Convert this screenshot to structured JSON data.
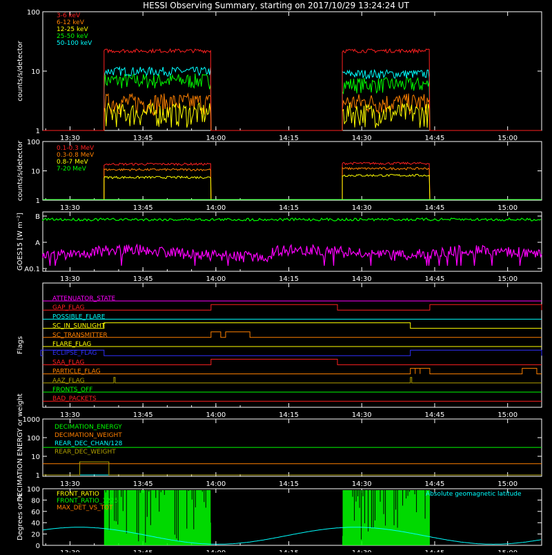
{
  "title": "HESSI Observing Summary, starting on 2017/10/29 13:24:24 UT",
  "time_ticks": [
    "13:30",
    "13:45",
    "14:00",
    "14:15",
    "14:30",
    "14:45",
    "15:00"
  ],
  "colors": {
    "background": "#000000",
    "axes": "#ffffff",
    "red": "#ff2020",
    "orange": "#ff8000",
    "yellow": "#ffff00",
    "green": "#00ff00",
    "cyan": "#00ffff",
    "magenta": "#ff00ff",
    "blue": "#3030ff",
    "olive": "#b0a000"
  },
  "chart_data": [
    {
      "type": "line",
      "panel": "count-rate-low",
      "ylabel": "counts/s/detector",
      "yscale": "log",
      "ylim": [
        1,
        100
      ],
      "yticks": [
        "1",
        "10",
        "100"
      ],
      "x_range": [
        "13:24:24",
        "15:07"
      ],
      "series": [
        {
          "name": "3-6 keV",
          "color": "#ff2020",
          "values_by_interval": [
            {
              "start": "13:37",
              "end": "13:59",
              "level": 22
            },
            {
              "start": "14:26",
              "end": "14:44",
              "level": 22
            }
          ]
        },
        {
          "name": "6-12 keV",
          "color": "#ff8000",
          "values_by_interval": [
            {
              "start": "13:37",
              "end": "13:59",
              "level": 3
            },
            {
              "start": "14:26",
              "end": "14:44",
              "level": 3
            }
          ]
        },
        {
          "name": "12-25 keV",
          "color": "#ffff00",
          "values_by_interval": [
            {
              "start": "13:37",
              "end": "13:59",
              "level": 2
            },
            {
              "start": "14:26",
              "end": "14:44",
              "level": 2
            }
          ]
        },
        {
          "name": "25-50 keV",
          "color": "#00ff00",
          "values_by_interval": [
            {
              "start": "13:37",
              "end": "13:59",
              "level": 7
            },
            {
              "start": "14:26",
              "end": "14:44",
              "level": 6
            }
          ]
        },
        {
          "name": "50-100 keV",
          "color": "#00ffff",
          "values_by_interval": [
            {
              "start": "13:37",
              "end": "13:59",
              "level": 10
            },
            {
              "start": "14:26",
              "end": "14:44",
              "level": 9
            }
          ]
        }
      ]
    },
    {
      "type": "line",
      "panel": "count-rate-high",
      "ylabel": "counts/s/detector",
      "yscale": "log",
      "ylim": [
        1,
        100
      ],
      "yticks": [
        "1",
        "10",
        "100"
      ],
      "series": [
        {
          "name": "0.1-0.3 MeV",
          "color": "#ff2020",
          "values_by_interval": [
            {
              "start": "13:37",
              "end": "13:59",
              "level": 17
            },
            {
              "start": "14:26",
              "end": "14:44",
              "level": 18
            }
          ]
        },
        {
          "name": "0.3-0.8 MeV",
          "color": "#ff8000",
          "values_by_interval": [
            {
              "start": "13:37",
              "end": "13:59",
              "level": 11
            },
            {
              "start": "14:26",
              "end": "14:44",
              "level": 12
            }
          ]
        },
        {
          "name": "0.8-7 MeV",
          "color": "#ffff00",
          "values_by_interval": [
            {
              "start": "13:37",
              "end": "13:59",
              "level": 6
            },
            {
              "start": "14:26",
              "end": "14:44",
              "level": 7
            }
          ]
        },
        {
          "name": "7-20 MeV",
          "color": "#00ff00",
          "values_by_interval": [
            {
              "start": "13:24",
              "end": "15:07",
              "level": 1
            }
          ]
        }
      ]
    },
    {
      "type": "line",
      "panel": "goes",
      "ylabel": "GOES15 [W m⁻²]",
      "yticks": [
        "A0.1",
        "A",
        "B"
      ],
      "series": [
        {
          "name": "GOES long",
          "color": "#00ff00",
          "level_class": "B-",
          "trend": "flat"
        },
        {
          "name": "GOES short",
          "color": "#ff00ff",
          "level_class": "A0.2-A0.5",
          "trend": "noisy"
        }
      ]
    },
    {
      "type": "line",
      "panel": "flags",
      "ylabel": "Flags",
      "flags": [
        {
          "name": "ATTENUATOR_STATE",
          "color": "#ff00ff",
          "on_intervals": []
        },
        {
          "name": "GAP_FLAG",
          "color": "#ff2020",
          "on_intervals": [
            [
              "13:59",
              "14:25"
            ],
            [
              "14:44",
              "15:07"
            ]
          ]
        },
        {
          "name": "POSSIBLE_FLARE",
          "color": "#00ffff",
          "on_intervals": []
        },
        {
          "name": "SC_IN_SUNLIGHT",
          "color": "#ffff00",
          "on_intervals": [
            [
              "13:37",
              "14:40"
            ]
          ]
        },
        {
          "name": "SC_TRANSMITTER",
          "color": "#ff8000",
          "on_intervals": [
            [
              "13:59",
              "14:01"
            ],
            [
              "14:02",
              "14:07"
            ]
          ]
        },
        {
          "name": "FLARE_FLAG",
          "color": "#ffff00",
          "on_intervals": []
        },
        {
          "name": "ECLIPSE_FLAG",
          "color": "#3030ff",
          "on_intervals": [
            [
              "13:24",
              "13:37"
            ],
            [
              "14:40",
              "15:07"
            ]
          ]
        },
        {
          "name": "SAA_FLAG",
          "color": "#ff2020",
          "on_intervals": [
            [
              "13:59",
              "14:25"
            ]
          ]
        },
        {
          "name": "PARTICLE_FLAG",
          "color": "#ff8000",
          "on_intervals": [
            [
              "14:40",
              "14:41"
            ],
            [
              "14:41",
              "14:42"
            ],
            [
              "14:42",
              "14:44"
            ],
            [
              "15:03",
              "15:06"
            ]
          ]
        },
        {
          "name": "AAZ_FLAG",
          "color": "#b0a000",
          "on_intervals": [
            [
              "13:39",
              "13:39"
            ],
            [
              "14:40",
              "14:40"
            ]
          ]
        },
        {
          "name": "FRONTS_OFF",
          "color": "#00ff00",
          "on_intervals": []
        },
        {
          "name": "BAD_PACKETS",
          "color": "#ff2020",
          "on_intervals": []
        }
      ]
    },
    {
      "type": "line",
      "panel": "decimation",
      "ylabel": "DECIMATION ENERGY or weight",
      "yscale": "log",
      "ylim": [
        1,
        1000
      ],
      "yticks": [
        "1",
        "10",
        "100",
        "1000"
      ],
      "series": [
        {
          "name": "DECIMATION_ENERGY",
          "color": "#00ff00",
          "level": 30
        },
        {
          "name": "DECIMATION_WEIGHT",
          "color": "#ff8000",
          "level": 4
        },
        {
          "name": "REAR_DEC_CHAN/128",
          "color": "#00ffff",
          "level": 1
        },
        {
          "name": "REAR_DEC_WEIGHT",
          "color": "#b0a000",
          "level": 1,
          "on_interval": [
            "13:32",
            "13:38"
          ],
          "on_level": 5
        }
      ]
    },
    {
      "type": "line",
      "panel": "ratio",
      "ylabel": "Degrees or %",
      "ylim": [
        0,
        100
      ],
      "yticks": [
        "0",
        "20",
        "40",
        "60",
        "80",
        "100"
      ],
      "series": [
        {
          "name": "FRONT_RATIO",
          "color": "#ffff00"
        },
        {
          "name": "FRONT_RATIO_1225",
          "color": "#00ff00",
          "on_intervals": [
            [
              "13:37",
              "13:59"
            ],
            [
              "14:26",
              "14:44"
            ]
          ]
        },
        {
          "name": "MAX_DET_VS_TOT",
          "color": "#ff8000"
        },
        {
          "name": "Absolute geomagnetic latitude",
          "color": "#00ffff",
          "minima": [
            "13:37",
            "13:59",
            "14:37"
          ],
          "maxima": [
            "13:26",
            "13:47",
            "14:19",
            "14:52"
          ],
          "range": [
            0,
            33
          ]
        }
      ]
    }
  ]
}
